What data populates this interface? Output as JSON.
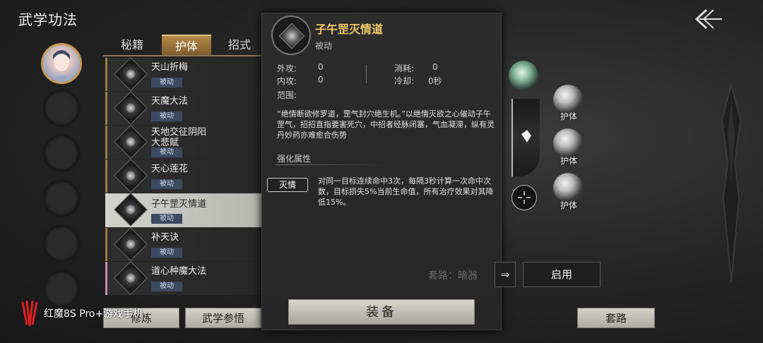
{
  "page": {
    "title": "武学功法"
  },
  "tabs": [
    {
      "label": "秘籍",
      "active": false
    },
    {
      "label": "护体",
      "active": true
    },
    {
      "label": "招式",
      "active": false
    }
  ],
  "skills": [
    {
      "name": "天山折梅",
      "badge": "被动"
    },
    {
      "name": "天魔大法",
      "badge": "被动"
    },
    {
      "name": "天地交征阴阳大悲赋",
      "badge": "被动"
    },
    {
      "name": "天心莲花",
      "badge": "被动"
    },
    {
      "name": "子午罡灭情道",
      "badge": "被动"
    },
    {
      "name": "补天诀",
      "badge": "被动"
    },
    {
      "name": "道心种魔大法",
      "badge": "被动"
    }
  ],
  "bottom_buttons": {
    "cultivate": "修炼",
    "study": "武学参悟",
    "set": "套路"
  },
  "watermark": {
    "text": "红魔8S Pro+游戏手机"
  },
  "detail": {
    "name": "子午罡灭情道",
    "type": "被动",
    "outer_attack_label": "外攻:",
    "outer_attack_value": "0",
    "inner_attack_label": "内攻:",
    "inner_attack_value": "0",
    "cost_label": "消耗:",
    "cost_value": "0",
    "cooldown_label": "冷却:",
    "cooldown_value": "0秒",
    "range_label": "范围:",
    "description": "“绝情断欲修罗道，罡气封穴绝生机。”以绝情灭欲之心催动子午罡气，招招直指要害死穴，中招者经脉闭塞，气血凝滞，纵有灵丹妙药亦难愈合伤势",
    "enhance_title": "强化属性",
    "enhance_tag": "灭情",
    "enhance_text": "对同一目标连续命中3次，每隔3秒计算一次命中次数，目标损失5%当前生命值，所有治疗效果对其降低15%。",
    "equip_label": "装备"
  },
  "right": {
    "slot_labels": [
      "护体",
      "护体",
      "护体"
    ],
    "set_label": "套路：暗器",
    "enable_label": "启用"
  }
}
